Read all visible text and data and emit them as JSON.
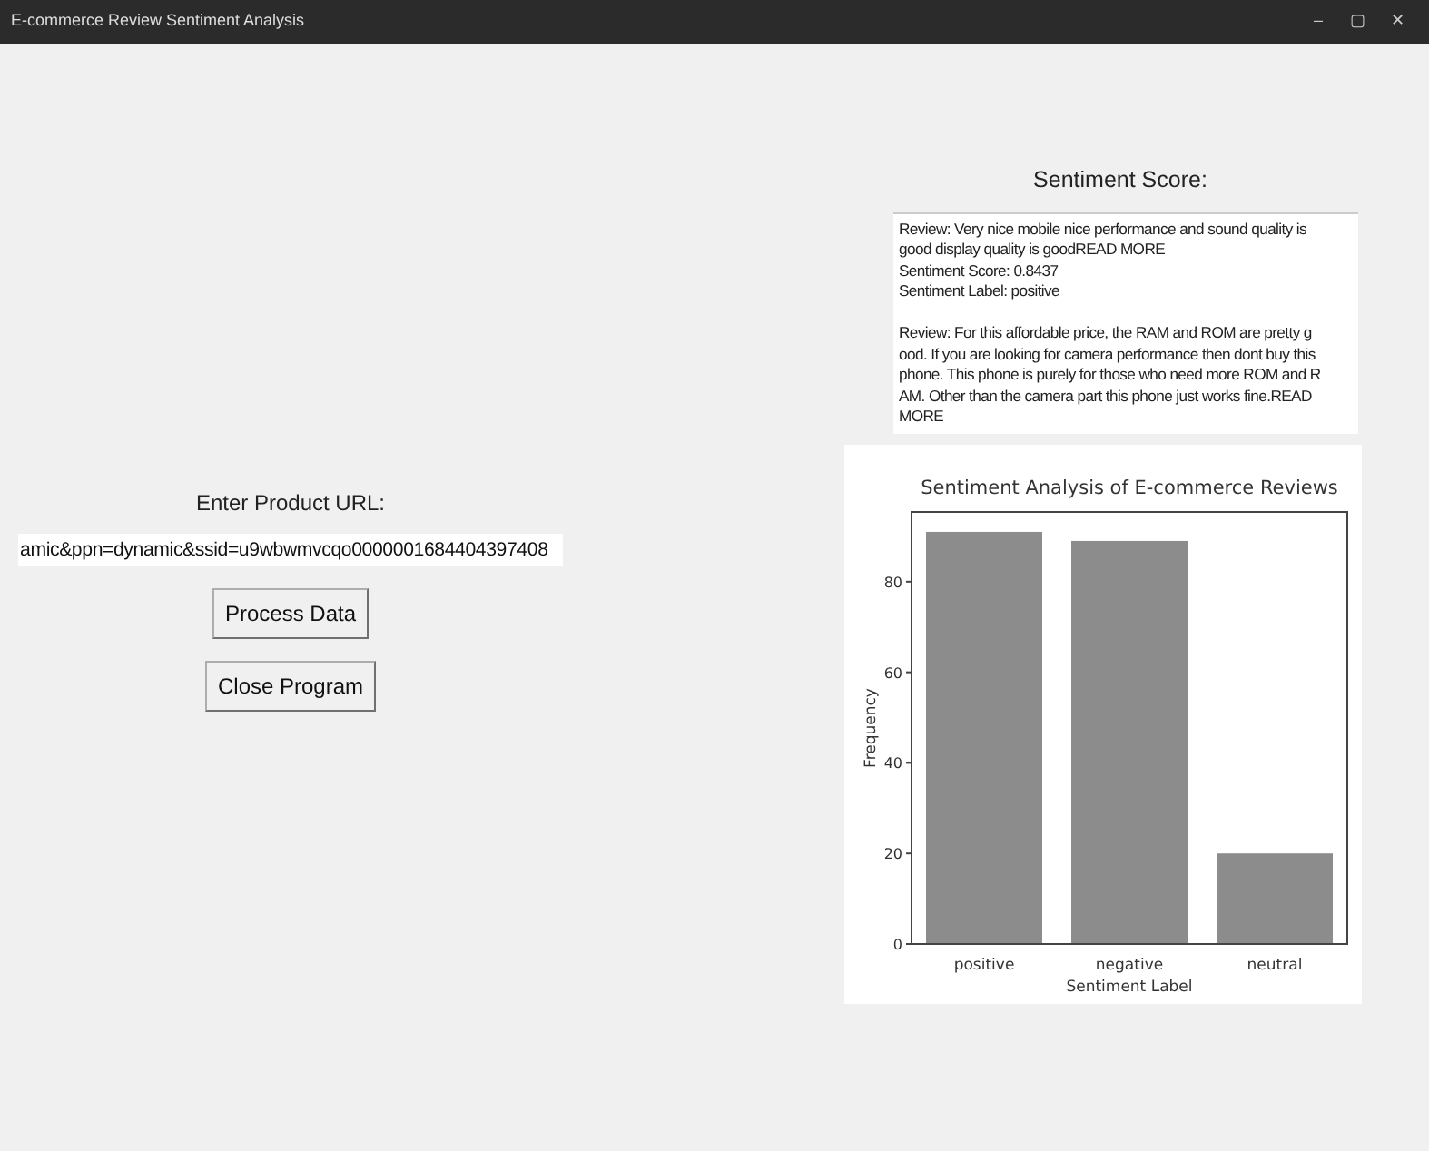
{
  "window": {
    "title": "E-commerce Review Sentiment Analysis",
    "controls": [
      "–",
      "▢",
      "✕"
    ]
  },
  "url_label": "Enter Product URL:",
  "url_field": {
    "value": "amic&ppn=dynamic&ssid=u9wbwmvcqo0000001684404397408"
  },
  "buttons": [
    "Process Data",
    "Close Program"
  ],
  "score_title": "Sentiment Score:",
  "score_text": {
    "entries": [
      {
        "lines": [
          "Review: Very nice mobile nice performance and sound quality is",
          "good display quality is goodREAD MORE",
          "Sentiment Score: 0.8437",
          "Sentiment Label: positive"
        ]
      },
      {
        "lines": [
          "Review: For this affordable price, the RAM and ROM are pretty g",
          "ood. If you are looking for camera performance then dont buy this",
          "phone. This phone is purely for those who need more ROM and R",
          "AM. Other than the camera part this phone just works fine.READ",
          "MORE"
        ]
      }
    ]
  },
  "chart": {
    "chart_data": {
      "type": "bar",
      "title": "Sentiment Analysis of E-commerce Reviews",
      "xlabel": "Sentiment Label",
      "ylabel": "Frequency",
      "categories": [
        "positive",
        "negative",
        "neutral"
      ],
      "values": [
        91,
        89,
        20
      ],
      "ylim": [
        0,
        95.4
      ],
      "yticks": [
        0,
        20,
        40,
        60,
        80
      ]
    }
  }
}
